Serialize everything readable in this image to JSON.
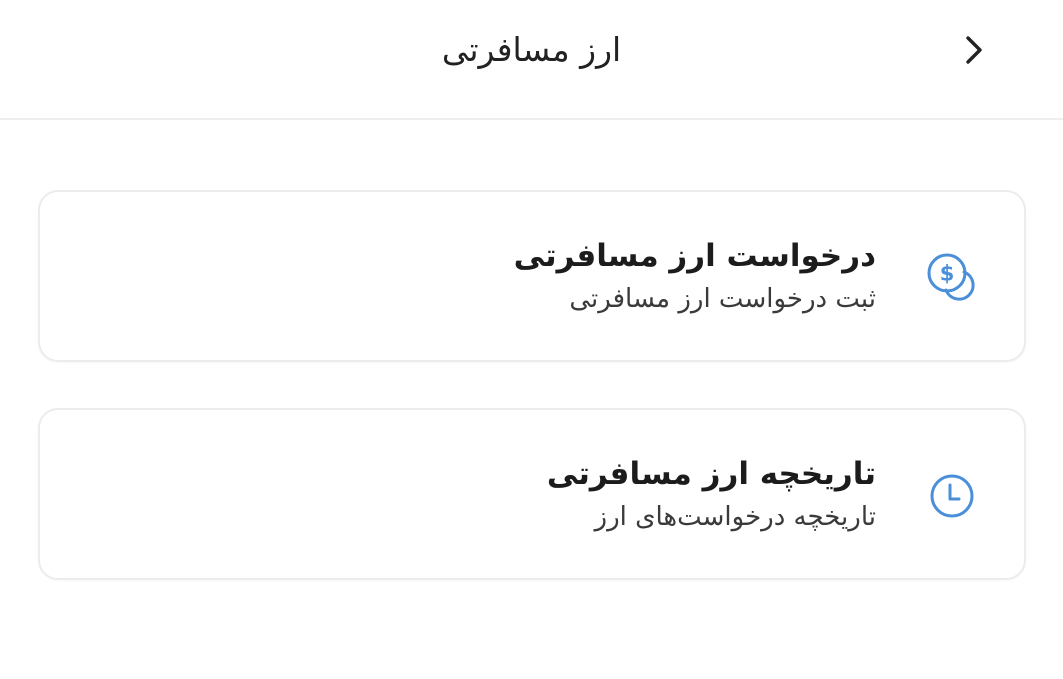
{
  "header": {
    "title": "ارز مسافرتی",
    "back_icon": "chevron-right-icon"
  },
  "menu": {
    "items": [
      {
        "title": "درخواست ارز مسافرتی",
        "subtitle": "ثبت درخواست ارز مسافرتی",
        "icon": "dollar-coin-icon"
      },
      {
        "title": "تاریخچه ارز مسافرتی",
        "subtitle": "تاریخچه درخواست‌های ارز",
        "icon": "clock-icon"
      }
    ]
  },
  "colors": {
    "accent": "#4a8fd8",
    "border": "#ececec",
    "divider": "#eeeeee"
  }
}
